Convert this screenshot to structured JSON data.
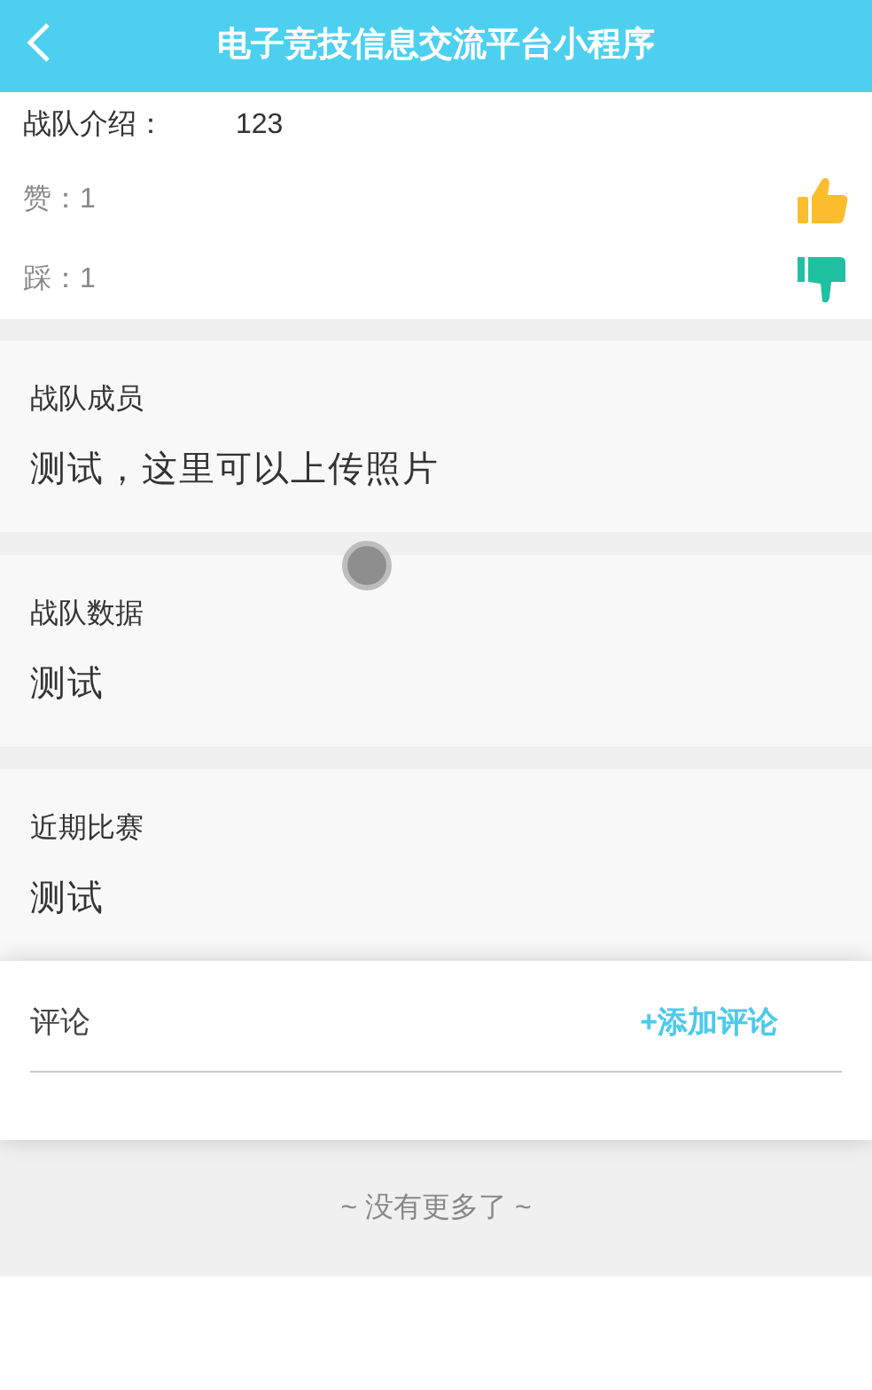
{
  "header": {
    "title": "电子竞技信息交流平台小程序"
  },
  "intro": {
    "label": "战队介绍：",
    "value": "123"
  },
  "votes": [
    {
      "kind": "like",
      "label": "赞：1"
    },
    {
      "kind": "dislike",
      "label": "踩：1"
    }
  ],
  "sections": [
    {
      "title": "战队成员",
      "body": "测试，这里可以上传照片"
    },
    {
      "title": "战队数据",
      "body": "测试"
    },
    {
      "title": "近期比赛",
      "body": "测试"
    }
  ],
  "comments": {
    "title": "评论",
    "add_button": "+添加评论"
  },
  "footer": {
    "text": "~ 没有更多了 ~"
  }
}
